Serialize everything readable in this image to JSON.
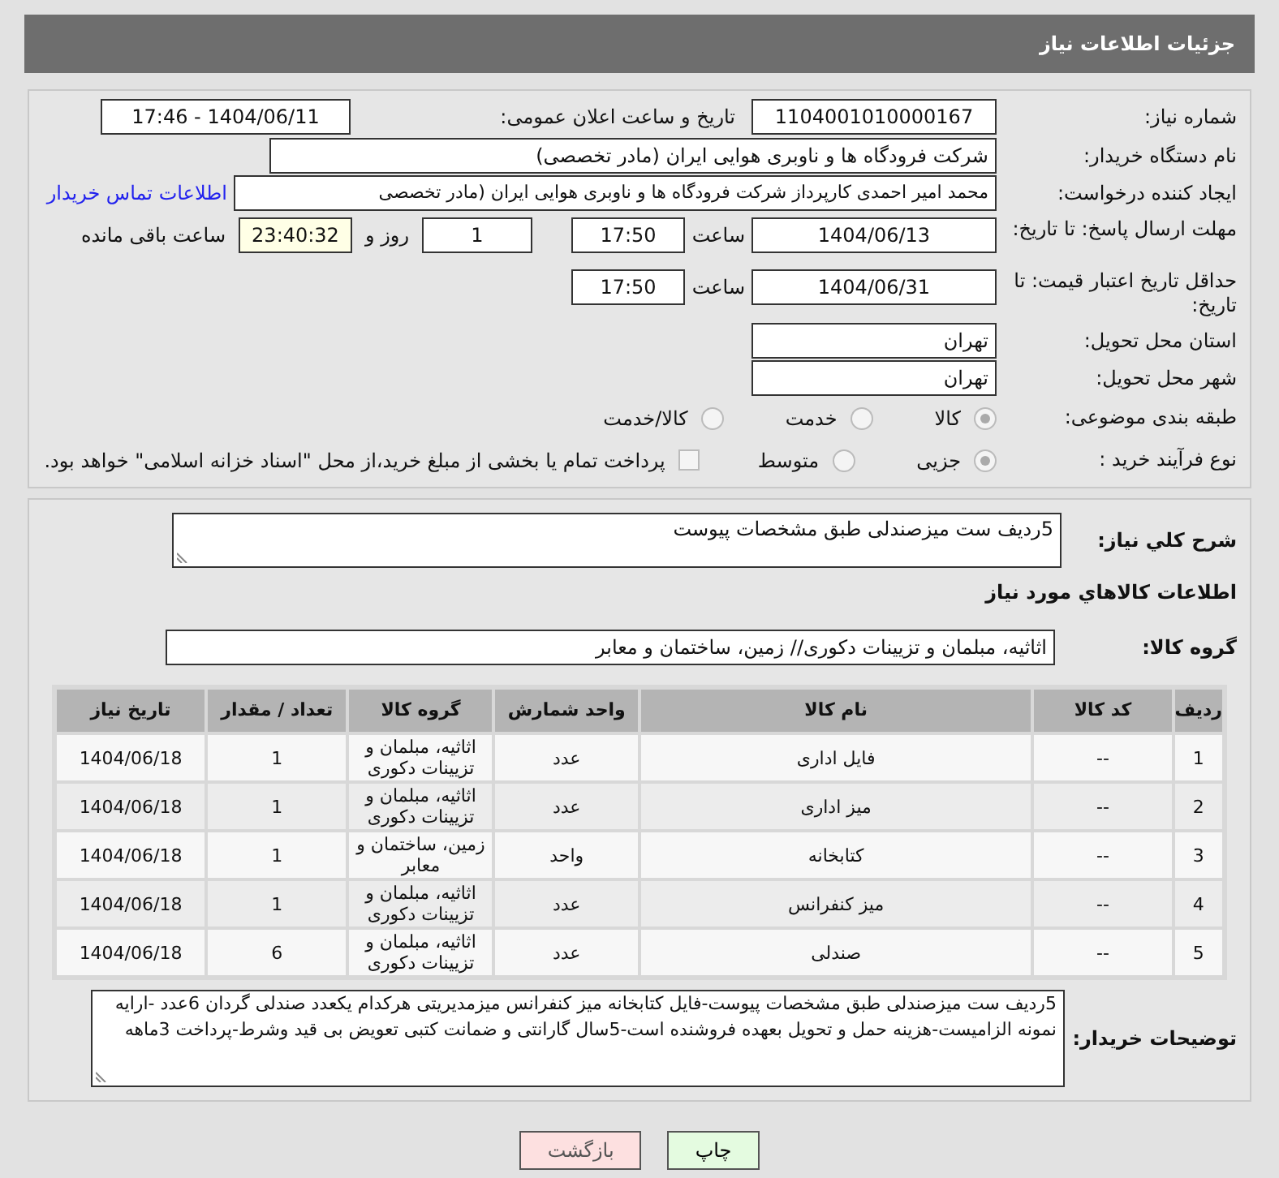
{
  "header": {
    "title": "جزئیات اطلاعات نیاز"
  },
  "need_number": {
    "label": "شماره نیاز:",
    "value": "1104001010000167"
  },
  "announce": {
    "label": "تاریخ و ساعت اعلان عمومی:",
    "value": "1404/06/11 - 17:46"
  },
  "buyer": {
    "label": "نام دستگاه خریدار:",
    "value": "شرکت فرودگاه ها و ناوبری هوایی ایران (مادر تخصصی)"
  },
  "creator": {
    "label": "ایجاد کننده درخواست:",
    "value": "محمد امیر احمدی کارپرداز شرکت فرودگاه ها و ناوبری هوایی ایران (مادر تخصصی",
    "link": "اطلاعات تماس خریدار"
  },
  "deadline": {
    "label": "مهلت ارسال پاسخ: تا تاریخ:",
    "date": "1404/06/13",
    "time_label": "ساعت",
    "time": "17:50",
    "days": "1",
    "days_label": "روز و",
    "remaining": "23:40:32",
    "remaining_label": "ساعت باقی مانده"
  },
  "validity": {
    "label": "حداقل تاریخ اعتبار قیمت: تا تاریخ:",
    "date": "1404/06/31",
    "time_label": "ساعت",
    "time": "17:50"
  },
  "province": {
    "label": "استان محل تحویل:",
    "value": "تهران"
  },
  "city": {
    "label": "شهر محل تحویل:",
    "value": "تهران"
  },
  "category": {
    "label": "طبقه بندی موضوعی:",
    "options": [
      {
        "label": "کالا",
        "selected": true
      },
      {
        "label": "خدمت",
        "selected": false
      },
      {
        "label": "کالا/خدمت",
        "selected": false
      }
    ]
  },
  "process": {
    "label": "نوع فرآیند خرید :",
    "options": [
      {
        "label": "جزیی",
        "selected": true
      },
      {
        "label": "متوسط",
        "selected": false
      }
    ],
    "payment": {
      "label": "پرداخت تمام یا بخشی از مبلغ خرید،از محل \"اسناد خزانه اسلامی\" خواهد بود.",
      "checked": false
    }
  },
  "description": {
    "label": "شرح كلي نياز:",
    "value": "5ردیف ست میزصندلی طبق مشخصات پیوست"
  },
  "goods_title": "اطلاعات كالاهاي مورد نياز",
  "goods_group": {
    "label": "گروه کالا:",
    "value": "اثاثیه، مبلمان و تزیینات دکوری// زمین، ساختمان و معابر"
  },
  "table": {
    "columns": [
      "ردیف",
      "کد کالا",
      "نام کالا",
      "واحد شمارش",
      "گروه کالا",
      "تعداد / مقدار",
      "تاریخ نیاز"
    ],
    "rows": [
      [
        "1",
        "--",
        "فایل اداری",
        "عدد",
        "اثاثیه، مبلمان و تزیینات دکوری",
        "1",
        "1404/06/18"
      ],
      [
        "2",
        "--",
        "میز اداری",
        "عدد",
        "اثاثیه، مبلمان و تزیینات دکوری",
        "1",
        "1404/06/18"
      ],
      [
        "3",
        "--",
        "کتابخانه",
        "واحد",
        "زمین، ساختمان و معابر",
        "1",
        "1404/06/18"
      ],
      [
        "4",
        "--",
        "میز کنفرانس",
        "عدد",
        "اثاثیه، مبلمان و تزیینات دکوری",
        "1",
        "1404/06/18"
      ],
      [
        "5",
        "--",
        "صندلی",
        "عدد",
        "اثاثیه، مبلمان و تزیینات دکوری",
        "6",
        "1404/06/18"
      ]
    ]
  },
  "notes": {
    "label": "توضیحات خریدار:",
    "value": "5ردیف ست میزصندلی طبق مشخصات پیوست-فایل کتابخانه میز کنفرانس میزمدیریتی هرکدام یکعدد صندلی گردان 6عدد -ارایه نمونه الزامیست-هزینه حمل و تحویل بعهده فروشنده است-5سال گارانتی و ضمانت کتبی تعویض بی قید وشرط-پرداخت 3ماهه"
  },
  "buttons": [
    {
      "kind": "print",
      "label": "چاپ"
    },
    {
      "kind": "back",
      "label": "بازگشت"
    }
  ]
}
